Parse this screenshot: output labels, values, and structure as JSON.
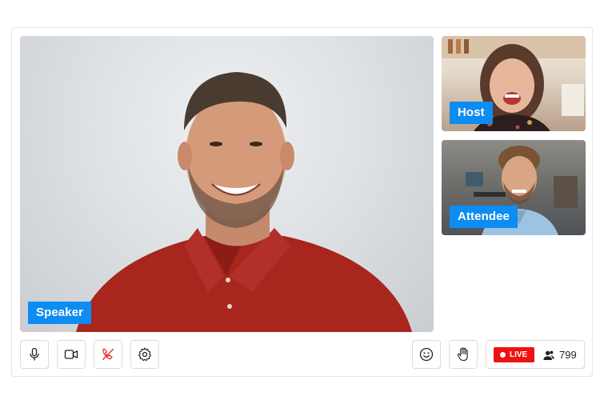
{
  "participants": {
    "speaker_label": "Speaker",
    "host_label": "Host",
    "attendee_label": "Attendee"
  },
  "controls": {
    "mic_icon": "microphone-icon",
    "camera_icon": "video-camera-icon",
    "hangup_icon": "phone-hangup-icon",
    "settings_icon": "gear-icon",
    "emoji_icon": "smiley-icon",
    "raise_hand_icon": "raise-hand-icon"
  },
  "live": {
    "badge_label": "LIVE",
    "viewer_count": "799",
    "badge_color": "#ee1212"
  },
  "colors": {
    "tag_accent": "#0d8cf2",
    "hangup": "#e02020"
  }
}
